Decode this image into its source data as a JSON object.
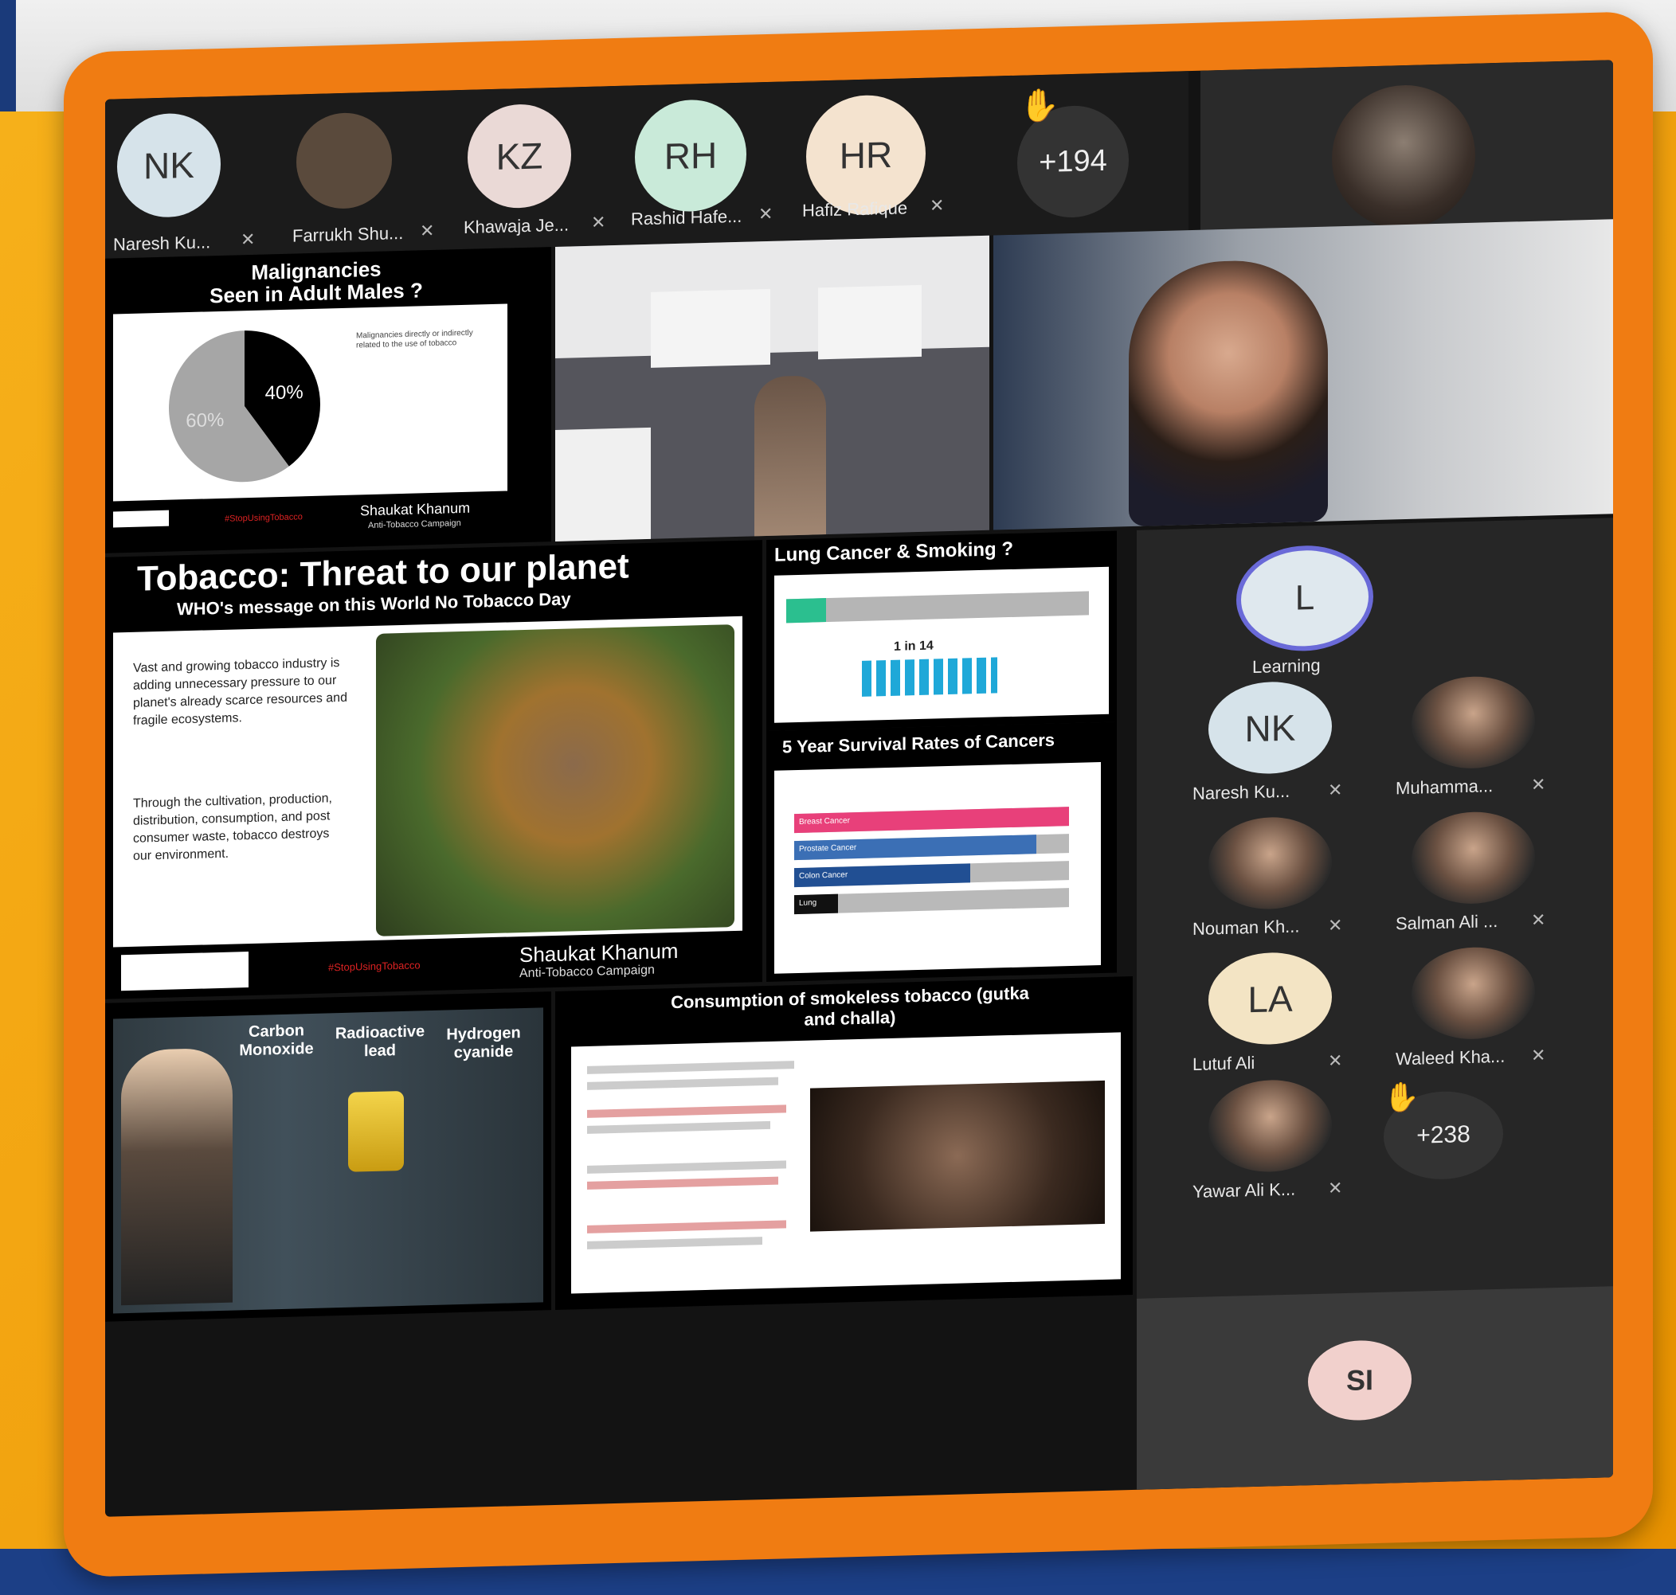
{
  "top_strip": {
    "participants": [
      {
        "initials": "NK",
        "name": "Naresh Ku...",
        "color": "#d6e3ea"
      },
      {
        "initials": "",
        "name": "Farrukh Shu...",
        "color": "#5a4a3c"
      },
      {
        "initials": "KZ",
        "name": "Khawaja Je...",
        "color": "#ead9d6"
      },
      {
        "initials": "RH",
        "name": "Rashid Hafe...",
        "color": "#c9ead9"
      },
      {
        "initials": "HR",
        "name": "Hafiz Rafique",
        "color": "#f4e3cf"
      }
    ],
    "more_count": "+194"
  },
  "slide_pie": {
    "title": "Malignancies\nSeen in Adult Males ?",
    "caption": "Malignancies directly or indirectly related to the use of tobacco",
    "brand": "Shaukat Khanum",
    "brand_sub": "Anti-Tobacco Campaign",
    "hashtag": "#StopUsingTobacco"
  },
  "chart_data": {
    "type": "pie",
    "categories": [
      "40%",
      "60%"
    ],
    "values": [
      40,
      60
    ],
    "colors": [
      "#000000",
      "#a6a6a6"
    ]
  },
  "slide_tobacco": {
    "title": "Tobacco: Threat to our planet",
    "subtitle": "WHO's message on this World No Tobacco Day",
    "para1": "Vast and growing tobacco industry is adding unnecessary pressure to our planet's already scarce resources and fragile ecosystems.",
    "para2": "Through the cultivation, production, distribution, consumption, and post consumer waste, tobacco destroys our environment.",
    "logo_name": "Shaukat Khanum",
    "hashtag": "#StopUsingTobacco",
    "brand": "Shaukat Khanum",
    "brand_sub": "Anti-Tobacco Campaign"
  },
  "slide_lung": {
    "title": "Lung Cancer & Smoking ?",
    "stat": "1 in 14"
  },
  "slide_survival": {
    "title": "5 Year Survival Rates of Cancers",
    "bars": [
      {
        "label": "Breast Cancer",
        "fill": 1.0,
        "color": "#e8407a"
      },
      {
        "label": "Prostate Cancer",
        "fill": 0.88,
        "color": "#3b6fb5"
      },
      {
        "label": "Colon Cancer",
        "fill": 0.64,
        "color": "#214f93"
      },
      {
        "label": "Lung",
        "fill": 0.16,
        "color": "#111111"
      }
    ]
  },
  "slide_gases": {
    "col1": "Carbon\nMonoxide",
    "col2": "Radioactive\nlead",
    "col3": "Hydrogen\ncyanide"
  },
  "slide_smokeless": {
    "title": "Consumption of smokeless tobacco (gutka\nand challa)"
  },
  "right_panel": {
    "big": {
      "initials": "L",
      "name": "Learning"
    },
    "participants": [
      {
        "initials": "NK",
        "name": "Naresh Ku...",
        "photo": false
      },
      {
        "initials": "",
        "name": "Muhamma...",
        "photo": true
      },
      {
        "initials": "",
        "name": "Nouman Kh...",
        "photo": true
      },
      {
        "initials": "",
        "name": "Salman Ali ...",
        "photo": true
      },
      {
        "initials": "LA",
        "name": "Lutuf Ali",
        "photo": false
      },
      {
        "initials": "",
        "name": "Waleed Kha...",
        "photo": true
      },
      {
        "initials": "",
        "name": "Yawar Ali K...",
        "photo": true
      }
    ],
    "more_count": "+238",
    "self_initials": "SI"
  }
}
